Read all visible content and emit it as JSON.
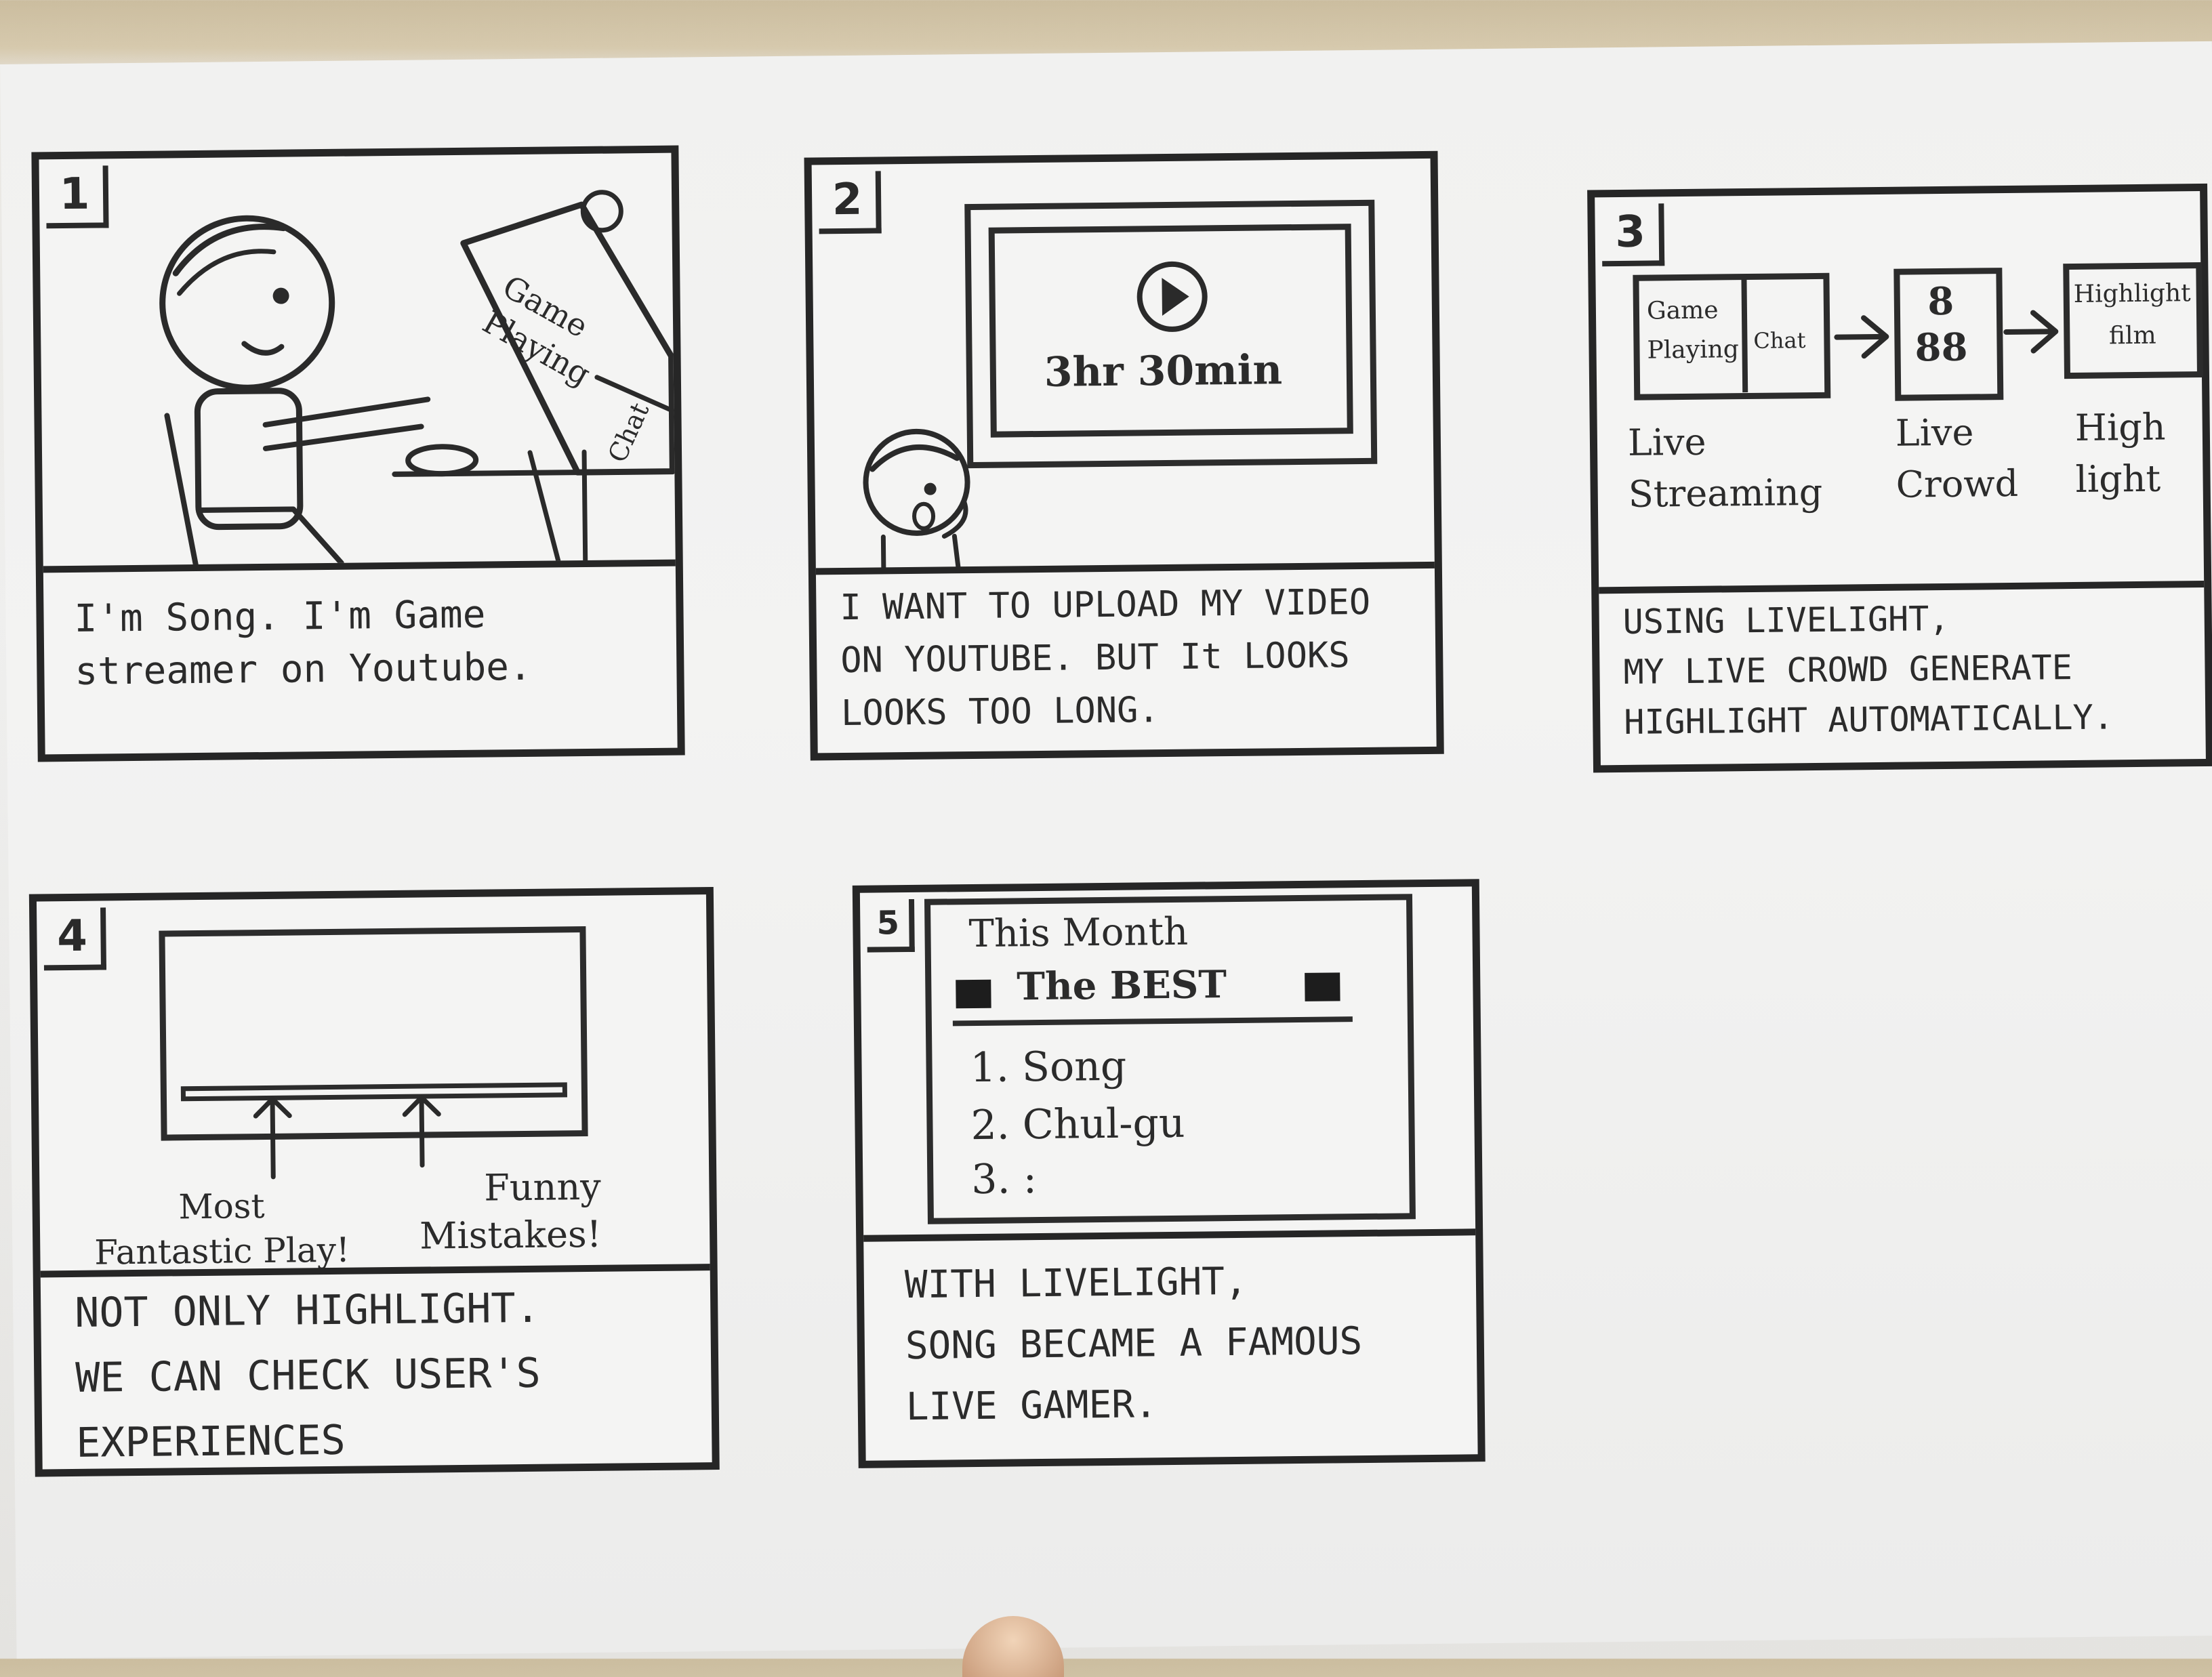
{
  "panels": [
    {
      "number": "1",
      "caption": "I'm Song. I'm Game\nstreamer on Youtube.",
      "monitor_text": "Game\nPlaying",
      "monitor_side_text": "Chat"
    },
    {
      "number": "2",
      "caption": "I WANT TO UPLOAD MY VIDEO\nON YOUTUBE. BUT It LOOKS\nLOOKS TOO LONG.",
      "video_duration": "3hr 30min"
    },
    {
      "number": "3",
      "caption": "USING LIVELIGHT,\nMY LIVE CROWD GENERATE\nHIGHLIGHT AUTOMATICALLY.",
      "flow": [
        {
          "box_text": "Game\nPlaying",
          "box_side_text": "Chat",
          "label": "Live\nStreaming"
        },
        {
          "box_text": "8\n88",
          "label": "Live\nCrowd"
        },
        {
          "box_text": "Highlight\nfilm",
          "label": "High\nlight"
        }
      ]
    },
    {
      "number": "4",
      "caption": "NOT ONLY HIGHLIGHT.\nWE CAN CHECK USER'S\nEXPERIENCES",
      "markers": [
        {
          "label": "Most\nFantastic Play!"
        },
        {
          "label": "Funny\nMistakes!"
        }
      ]
    },
    {
      "number": "5",
      "caption": "WITH LIVELIGHT,\nSONG BECAME A FAMOUS\nLIVE GAMER.",
      "ranking": {
        "heading_line1": "This Month",
        "heading_line2": "The BEST",
        "items": [
          "1.  Song",
          "2.  Chul-gu",
          "3.   :"
        ]
      }
    }
  ]
}
